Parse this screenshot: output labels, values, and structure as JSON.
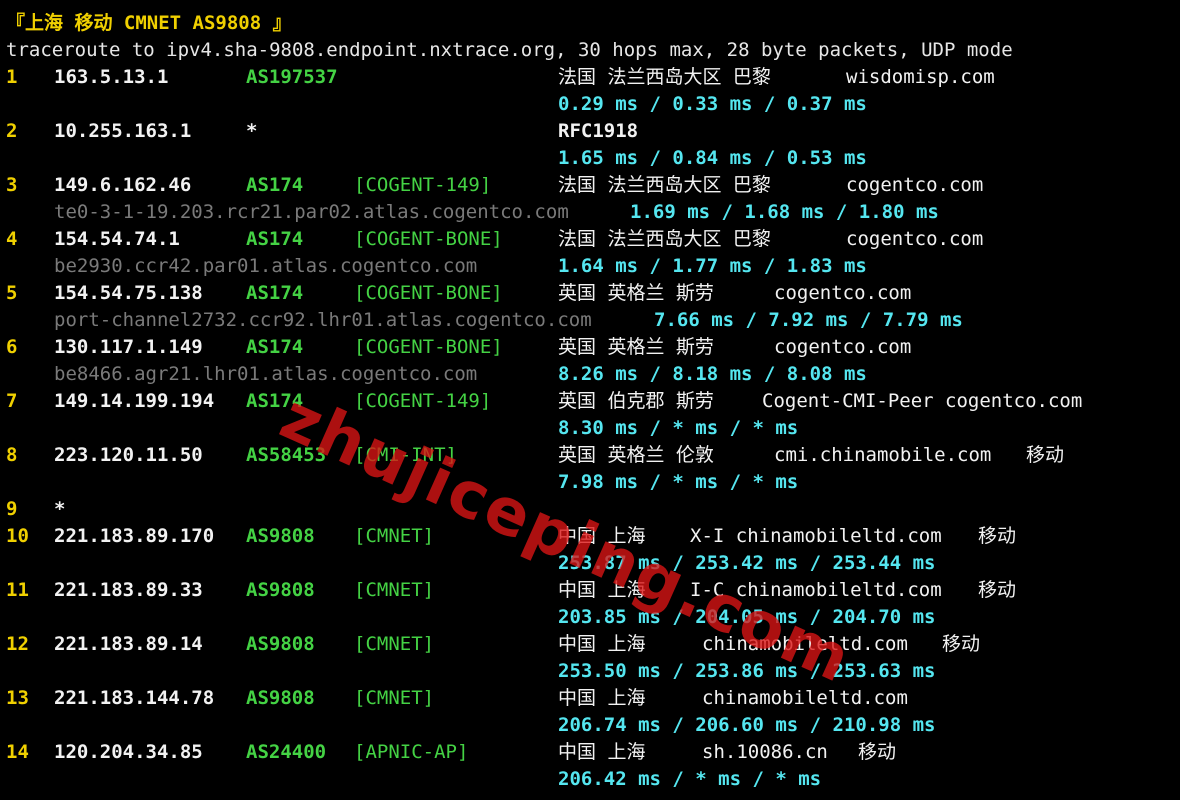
{
  "title": "『上海 移动 CMNET AS9808 』",
  "command": "traceroute to ipv4.sha-9808.endpoint.nxtrace.org, 30 hops max, 28 byte packets, UDP mode",
  "watermark": "zhujiceping.com",
  "colors": {
    "background": "#000000",
    "hop_number": "#f0d000",
    "asn": "#44d244",
    "rtt": "#55e6f0",
    "hostname": "#7a7a7a",
    "watermark": "#dc1414"
  },
  "hops": [
    {
      "hop": "1",
      "ip": "163.5.13.1",
      "asn": "AS197537",
      "tag": "",
      "geo": "法国 法兰西岛大区 巴黎",
      "domain": "wisdomisp.com",
      "isp": "",
      "hostname": "",
      "rtt": "0.29 ms / 0.33 ms / 0.37 ms"
    },
    {
      "hop": "2",
      "ip": "10.255.163.1",
      "asn": "*",
      "tag": "",
      "geo": "RFC1918",
      "domain": "",
      "isp": "",
      "hostname": "",
      "rtt": "1.65 ms / 0.84 ms / 0.53 ms"
    },
    {
      "hop": "3",
      "ip": "149.6.162.46",
      "asn": "AS174",
      "tag": "[COGENT-149]",
      "geo": "法国 法兰西岛大区 巴黎",
      "domain": "cogentco.com",
      "isp": "",
      "hostname": "te0-3-1-19.203.rcr21.par02.atlas.cogentco.com",
      "rtt": "1.69 ms / 1.68 ms / 1.80 ms"
    },
    {
      "hop": "4",
      "ip": "154.54.74.1",
      "asn": "AS174",
      "tag": "[COGENT-BONE]",
      "geo": "法国 法兰西岛大区 巴黎",
      "domain": "cogentco.com",
      "isp": "",
      "hostname": "be2930.ccr42.par01.atlas.cogentco.com",
      "rtt": "1.64 ms / 1.77 ms / 1.83 ms"
    },
    {
      "hop": "5",
      "ip": "154.54.75.138",
      "asn": "AS174",
      "tag": "[COGENT-BONE]",
      "geo": "英国 英格兰 斯劳",
      "domain": "cogentco.com",
      "isp": "",
      "hostname": "port-channel2732.ccr92.lhr01.atlas.cogentco.com",
      "rtt": "7.66 ms / 7.92 ms / 7.79 ms"
    },
    {
      "hop": "6",
      "ip": "130.117.1.149",
      "asn": "AS174",
      "tag": "[COGENT-BONE]",
      "geo": "英国 英格兰 斯劳",
      "domain": "cogentco.com",
      "isp": "",
      "hostname": "be8466.agr21.lhr01.atlas.cogentco.com",
      "rtt": "8.26 ms / 8.18 ms / 8.08 ms"
    },
    {
      "hop": "7",
      "ip": "149.14.199.194",
      "asn": "AS174",
      "tag": "[COGENT-149]",
      "geo": "英国 伯克郡 斯劳",
      "domain": "Cogent-CMI-Peer cogentco.com",
      "isp": "",
      "hostname": "",
      "rtt": "8.30 ms / * ms / * ms"
    },
    {
      "hop": "8",
      "ip": "223.120.11.50",
      "asn": "AS58453",
      "tag": "[CMI-INT]",
      "geo": "英国 英格兰 伦敦",
      "domain": "cmi.chinamobile.com",
      "isp": "移动",
      "hostname": "",
      "rtt": "7.98 ms / * ms / * ms"
    },
    {
      "hop": "9",
      "ip": "*",
      "asn": "",
      "tag": "",
      "geo": "",
      "domain": "",
      "isp": "",
      "hostname": "",
      "rtt": ""
    },
    {
      "hop": "10",
      "ip": "221.183.89.170",
      "asn": "AS9808",
      "tag": "[CMNET]",
      "geo": "中国 上海",
      "domain": "X-I chinamobileltd.com",
      "isp": "移动",
      "hostname": "",
      "rtt": "253.87 ms / 253.42 ms / 253.44 ms"
    },
    {
      "hop": "11",
      "ip": "221.183.89.33",
      "asn": "AS9808",
      "tag": "[CMNET]",
      "geo": "中国 上海",
      "domain": "I-C chinamobileltd.com",
      "isp": "移动",
      "hostname": "",
      "rtt": "203.85 ms / 204.05 ms / 204.70 ms"
    },
    {
      "hop": "12",
      "ip": "221.183.89.14",
      "asn": "AS9808",
      "tag": "[CMNET]",
      "geo": "中国 上海",
      "domain": "chinamobileltd.com",
      "isp": "移动",
      "hostname": "",
      "rtt": "253.50 ms / 253.86 ms / 253.63 ms"
    },
    {
      "hop": "13",
      "ip": "221.183.144.78",
      "asn": "AS9808",
      "tag": "[CMNET]",
      "geo": "中国 上海",
      "domain": "chinamobileltd.com",
      "isp": "",
      "hostname": "",
      "rtt": "206.74 ms / 206.60 ms / 210.98 ms"
    },
    {
      "hop": "14",
      "ip": "120.204.34.85",
      "asn": "AS24400",
      "tag": "[APNIC-AP]",
      "geo": "中国 上海",
      "domain": "sh.10086.cn",
      "isp": "移动",
      "hostname": "",
      "rtt": "206.42 ms / * ms / * ms"
    }
  ]
}
